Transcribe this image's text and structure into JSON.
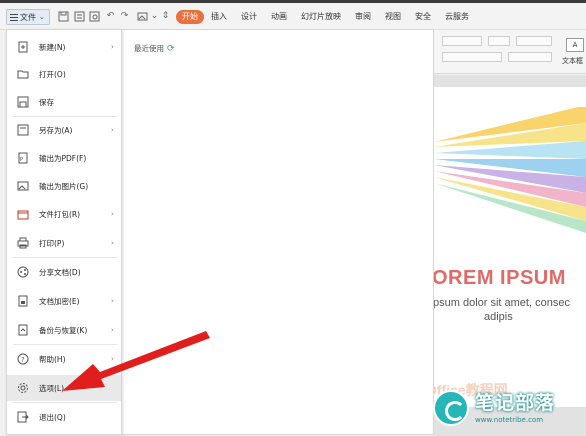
{
  "toolbar": {
    "file_label": "文件",
    "tabs": [
      {
        "label": "开始",
        "active": true
      },
      {
        "label": "插入"
      },
      {
        "label": "设计"
      },
      {
        "label": "动画"
      },
      {
        "label": "幻灯片放映"
      },
      {
        "label": "审阅"
      },
      {
        "label": "视图"
      },
      {
        "label": "安全"
      },
      {
        "label": "云服务"
      }
    ],
    "quick_icons": [
      "save-icon",
      "print-preview-icon",
      "export-pdf-icon",
      "undo-icon",
      "redo-icon",
      "insert-image-icon",
      "more-icon"
    ],
    "accent_color": "#e8713c"
  },
  "ribbon": {
    "textbox_label": "文本框"
  },
  "file_menu": {
    "items": [
      {
        "label": "新建(N)",
        "icon": "new-file-icon",
        "submenu": true
      },
      {
        "label": "打开(O)",
        "icon": "open-folder-icon",
        "submenu": false
      },
      {
        "label": "保存",
        "icon": "save-icon",
        "submenu": false
      },
      {
        "label": "另存为(A)",
        "icon": "save-as-icon",
        "submenu": true
      },
      {
        "label": "输出为PDF(F)",
        "icon": "export-pdf-icon",
        "submenu": false
      },
      {
        "label": "输出为图片(G)",
        "icon": "export-image-icon",
        "submenu": false
      },
      {
        "label": "文件打包(R)",
        "icon": "package-icon",
        "submenu": true
      },
      {
        "label": "打印(P)",
        "icon": "print-icon",
        "submenu": true
      },
      {
        "label": "分享文档(D)",
        "icon": "share-icon",
        "submenu": false
      },
      {
        "label": "文档加密(E)",
        "icon": "encrypt-icon",
        "submenu": true
      },
      {
        "label": "备份与恢复(K)",
        "icon": "backup-icon",
        "submenu": true
      },
      {
        "label": "帮助(H)",
        "icon": "help-icon",
        "submenu": true
      },
      {
        "label": "选项(L)",
        "icon": "gear-icon",
        "submenu": false,
        "selected": true
      },
      {
        "label": "退出(Q)",
        "icon": "exit-icon",
        "submenu": false
      }
    ]
  },
  "recent_panel": {
    "title": "最近使用"
  },
  "slide": {
    "title": "OREM IPSUM",
    "line1": "psum dolor sit amet, consec",
    "line2": "adipis",
    "title_color": "#e06a67"
  },
  "watermark": {
    "logo_text": "笔记部落",
    "url": "www.notetribe.com",
    "office_text": "Office教程网"
  }
}
